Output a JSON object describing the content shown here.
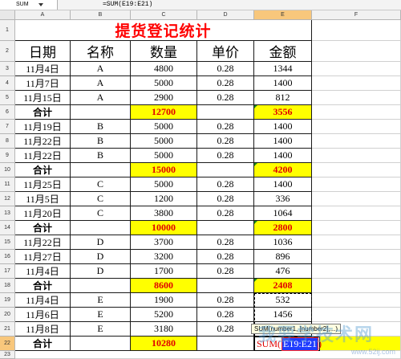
{
  "name_box": "SUM",
  "formula_bar": "=SUM(E19:E21)",
  "columns": [
    "A",
    "B",
    "C",
    "D",
    "E",
    "F"
  ],
  "rows": [
    "1",
    "2",
    "3",
    "4",
    "5",
    "6",
    "7",
    "8",
    "9",
    "10",
    "11",
    "12",
    "13",
    "14",
    "15",
    "16",
    "17",
    "18",
    "19",
    "20",
    "21",
    "22",
    "23"
  ],
  "title": "提货登记统计",
  "headers": {
    "date": "日期",
    "name": "名称",
    "qty": "数量",
    "price": "单价",
    "amount": "金额"
  },
  "r3": {
    "a": "11月4日",
    "b": "A",
    "c": "4800",
    "d": "0.28",
    "e": "1344"
  },
  "r4": {
    "a": "11月7日",
    "b": "A",
    "c": "5000",
    "d": "0.28",
    "e": "1400"
  },
  "r5": {
    "a": "11月15日",
    "b": "A",
    "c": "2900",
    "d": "0.28",
    "e": "812"
  },
  "r6": {
    "a": "合计",
    "c": "12700",
    "e": "3556"
  },
  "r7": {
    "a": "11月19日",
    "b": "B",
    "c": "5000",
    "d": "0.28",
    "e": "1400"
  },
  "r8": {
    "a": "11月22日",
    "b": "B",
    "c": "5000",
    "d": "0.28",
    "e": "1400"
  },
  "r9": {
    "a": "11月22日",
    "b": "B",
    "c": "5000",
    "d": "0.28",
    "e": "1400"
  },
  "r10": {
    "a": "合计",
    "c": "15000",
    "e": "4200"
  },
  "r11": {
    "a": "11月25日",
    "b": "C",
    "c": "5000",
    "d": "0.28",
    "e": "1400"
  },
  "r12": {
    "a": "11月5日",
    "b": "C",
    "c": "1200",
    "d": "0.28",
    "e": "336"
  },
  "r13": {
    "a": "11月20日",
    "b": "C",
    "c": "3800",
    "d": "0.28",
    "e": "1064"
  },
  "r14": {
    "a": "合计",
    "c": "10000",
    "e": "2800"
  },
  "r15": {
    "a": "11月22日",
    "b": "D",
    "c": "3700",
    "d": "0.28",
    "e": "1036"
  },
  "r16": {
    "a": "11月27日",
    "b": "D",
    "c": "3200",
    "d": "0.28",
    "e": "896"
  },
  "r17": {
    "a": "11月4日",
    "b": "D",
    "c": "1700",
    "d": "0.28",
    "e": "476"
  },
  "r18": {
    "a": "合计",
    "c": "8600",
    "e": "2408"
  },
  "r19": {
    "a": "11月4日",
    "b": "E",
    "c": "1900",
    "d": "0.28",
    "e": "532"
  },
  "r20": {
    "a": "11月6日",
    "b": "E",
    "c": "5200",
    "d": "0.28",
    "e": "1456"
  },
  "r21": {
    "a": "11月8日",
    "b": "E",
    "c": "3180",
    "d": "0.28",
    "e": "890.4"
  },
  "r22": {
    "a": "合计",
    "c": "10280"
  },
  "edit": {
    "fn": "SUM(",
    "ref": "E19:E21",
    "close": ")"
  },
  "tooltip": "SUM(number1, [number2],...)",
  "watermark": {
    "text": "我要学技术网",
    "url": "www.52ij.com"
  },
  "colors": {
    "sum_fill": "#ffff00",
    "sum_text": "#e00000",
    "title": "#ff0000",
    "active_header": "#f8c77c"
  }
}
